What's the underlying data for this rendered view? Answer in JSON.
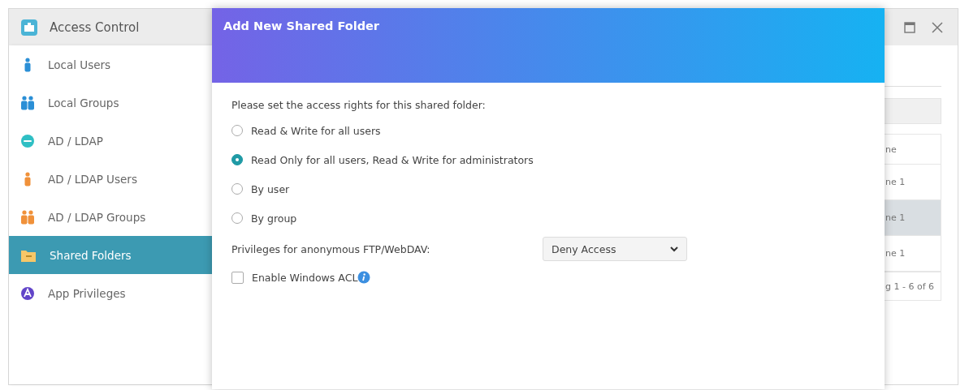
{
  "window": {
    "title": "Access Control"
  },
  "sidebar": {
    "items": [
      {
        "label": "Local Users",
        "selected": false
      },
      {
        "label": "Local Groups",
        "selected": false
      },
      {
        "label": "AD / LDAP",
        "selected": false
      },
      {
        "label": "AD / LDAP Users",
        "selected": false
      },
      {
        "label": "AD / LDAP Groups",
        "selected": false
      },
      {
        "label": "Shared Folders",
        "selected": true
      },
      {
        "label": "App Privileges",
        "selected": false
      }
    ]
  },
  "background_table": {
    "header": "ne",
    "rows": [
      {
        "cell": "ne 1",
        "selected": false
      },
      {
        "cell": "ne 1",
        "selected": true
      },
      {
        "cell": "ne 1",
        "selected": false
      }
    ],
    "footer": "g 1 - 6 of 6"
  },
  "dialog": {
    "title": "Add New Shared Folder",
    "prompt": "Please set the access rights for this shared folder:",
    "options": [
      {
        "label": "Read & Write for all users",
        "selected": false
      },
      {
        "label": "Read Only for all users, Read & Write for administrators",
        "selected": true
      },
      {
        "label": "By user",
        "selected": false
      },
      {
        "label": "By group",
        "selected": false
      }
    ],
    "anonymous_privileges": {
      "label": "Privileges for anonymous FTP/WebDAV:",
      "value": "Deny Access"
    },
    "windows_acl": {
      "label": "Enable Windows ACL",
      "checked": false
    }
  }
}
